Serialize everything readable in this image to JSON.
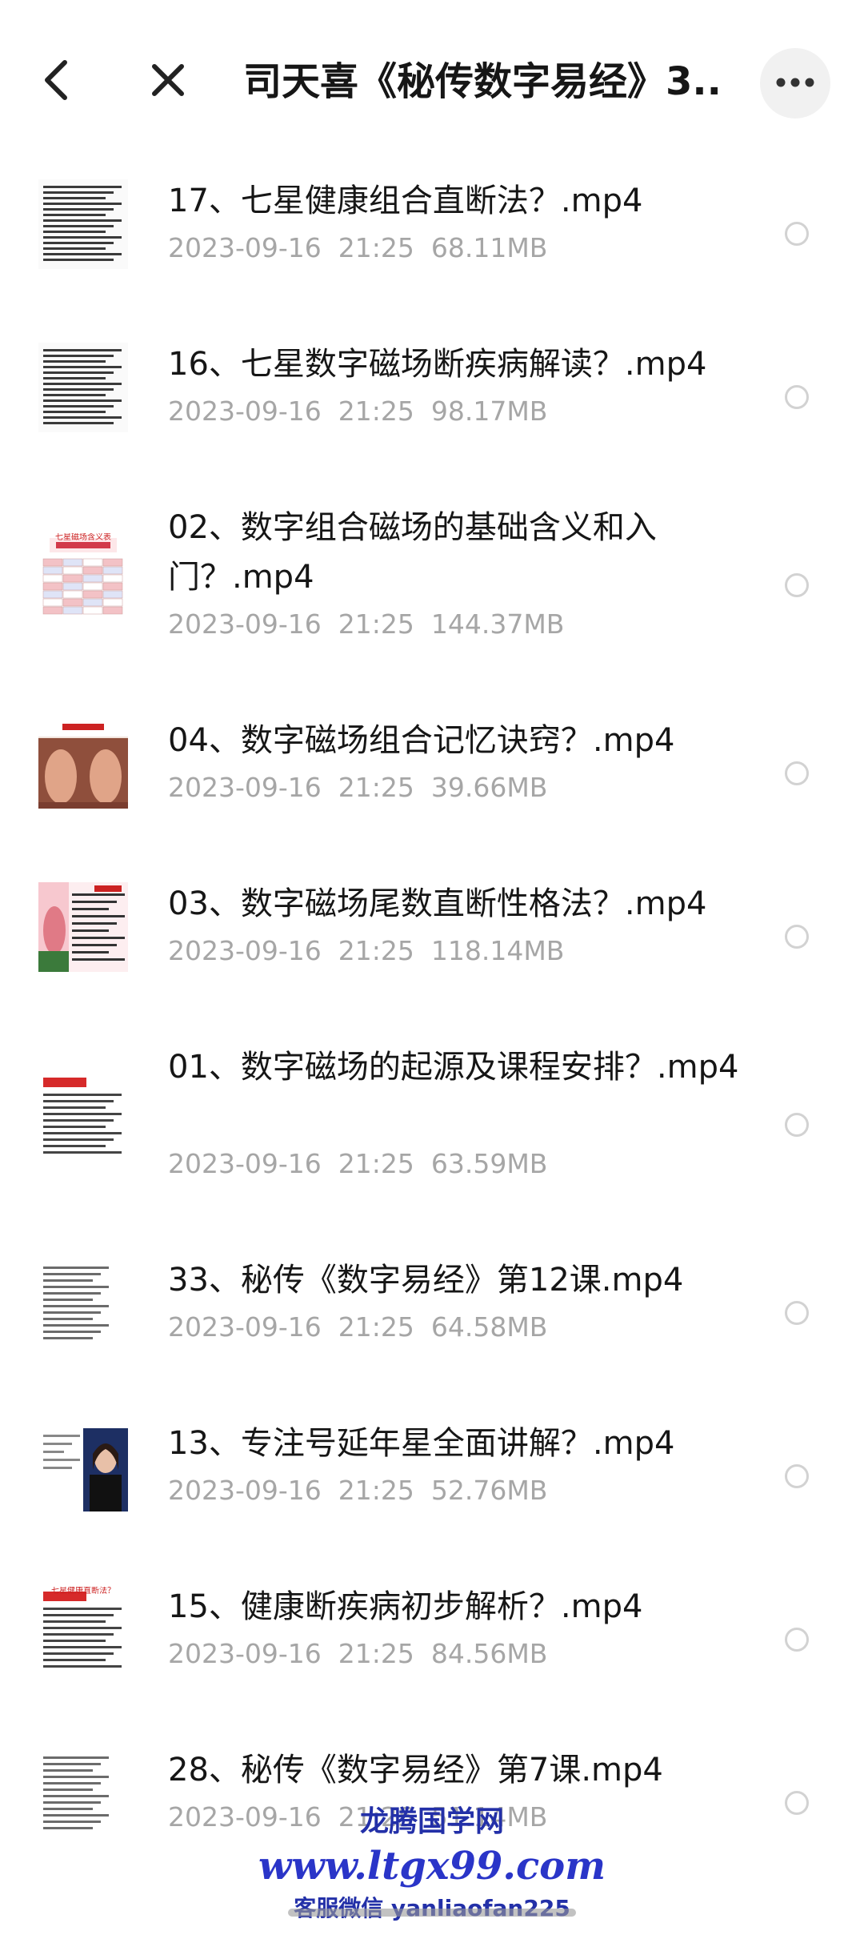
{
  "header": {
    "title": "司天喜《秘传数字易经》3...",
    "back_icon": "chevron-left-icon",
    "close_icon": "close-icon",
    "more_icon": "more-horizontal-icon"
  },
  "files": [
    {
      "name": "17、七星健康组合直断法？.mp4",
      "date": "2023-09-16  21:25",
      "size": "68.11MB",
      "thumb": "text-doc"
    },
    {
      "name": "16、七星数字磁场断疾病解读？.mp4",
      "date": "2023-09-16  21:25",
      "size": "98.17MB",
      "thumb": "text-doc"
    },
    {
      "name": "02、数字组合磁场的基础含义和入门？.mp4",
      "date": "2023-09-16  21:25",
      "size": "144.37MB",
      "thumb": "table-chart",
      "thumb_caption": "七星磁场含义表"
    },
    {
      "name": "04、数字磁场组合记忆诀窍？.mp4",
      "date": "2023-09-16  21:25",
      "size": "39.66MB",
      "thumb": "hands-photo"
    },
    {
      "name": "03、数字磁场尾数直断性格法？.mp4",
      "date": "2023-09-16  21:25",
      "size": "118.14MB",
      "thumb": "pink-slide"
    },
    {
      "name": "01、数字磁场的起源及课程安排？.mp4",
      "date": "2023-09-16  21:25",
      "size": "63.59MB",
      "thumb": "red-title-doc"
    },
    {
      "name": "33、秘传《数字易经》第12课.mp4",
      "date": "2023-09-16  21:25",
      "size": "64.58MB",
      "thumb": "list-doc"
    },
    {
      "name": "13、专注号延年星全面讲解？.mp4",
      "date": "2023-09-16  21:25",
      "size": "52.76MB",
      "thumb": "person-photo"
    },
    {
      "name": "15、健康断疾病初步解析？.mp4",
      "date": "2023-09-16  21:25",
      "size": "84.56MB",
      "thumb": "red-title-doc",
      "thumb_caption": "七星健康直断法？"
    },
    {
      "name": "28、秘传《数字易经》第7课.mp4",
      "date": "2023-09-16  21:25",
      "size": "51.14MB",
      "thumb": "list-doc"
    }
  ],
  "watermark": {
    "line1": "龙腾国学网",
    "line2": "www.ltgx99.com",
    "line3": "客服微信 yanliaofan225"
  },
  "colors": {
    "meta_text": "#a6a6a6",
    "radio_border": "#d2d2d2",
    "watermark_blue": "#2a35c8"
  }
}
